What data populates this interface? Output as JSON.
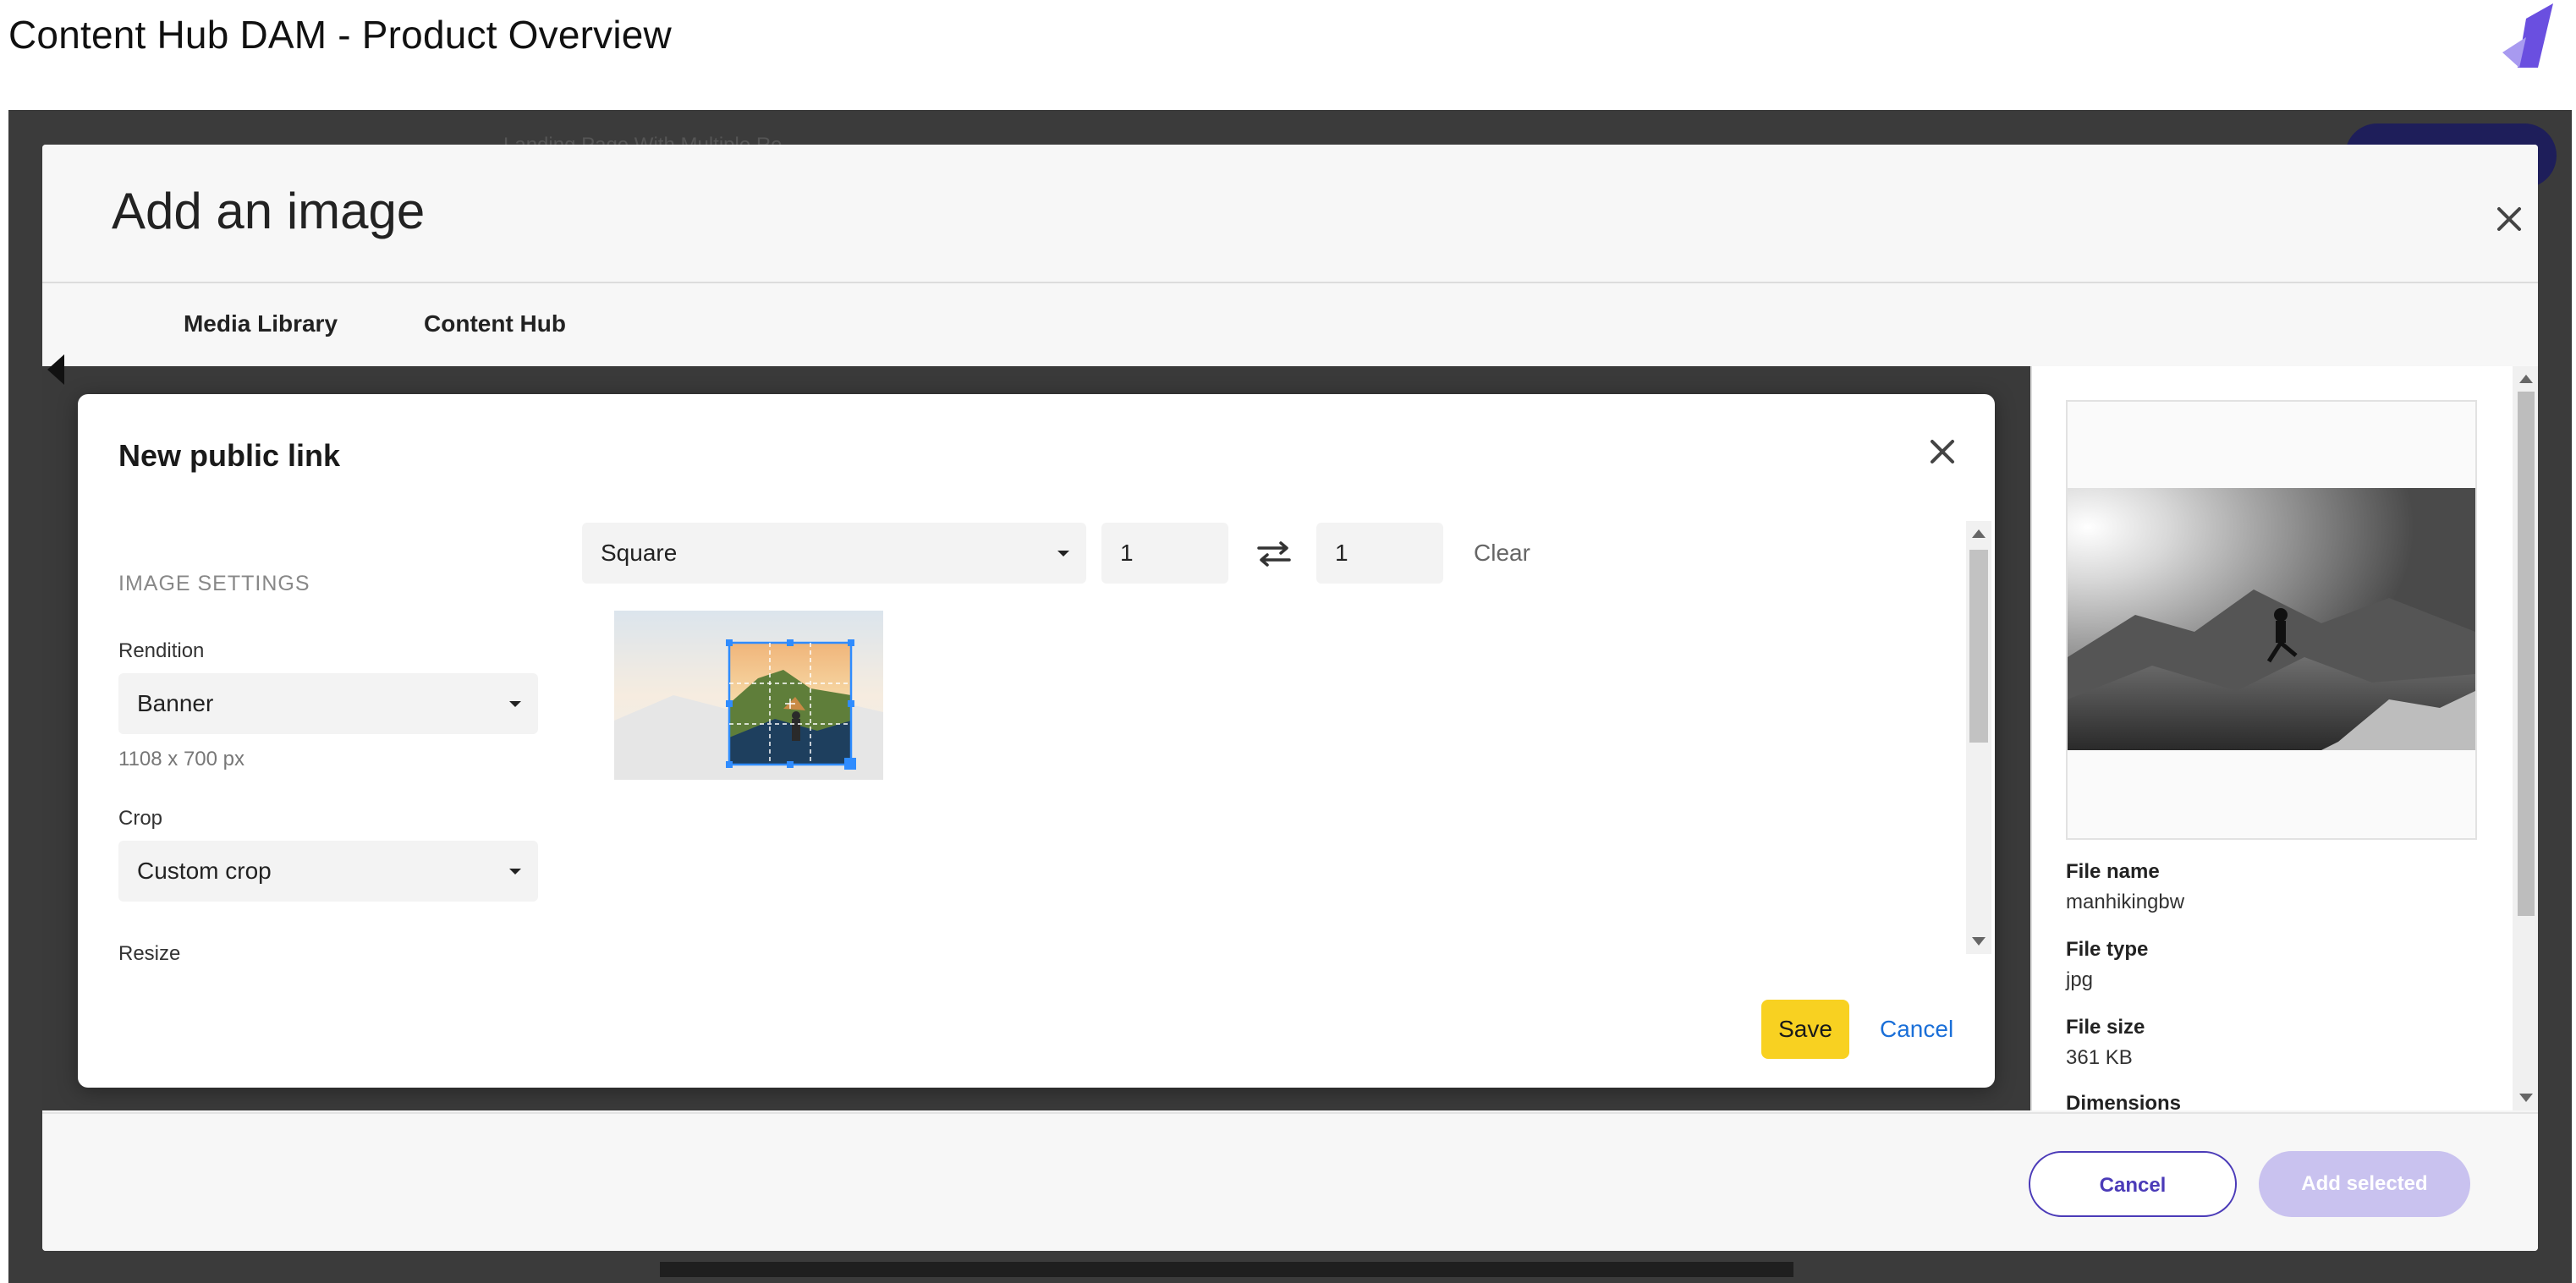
{
  "page": {
    "title": "Content Hub DAM - Product Overview"
  },
  "background": {
    "ghost_text": "Landing Page With Multiple Re..."
  },
  "add_image_modal": {
    "title": "Add an image",
    "tabs": [
      {
        "label": "Media Library",
        "active": false
      },
      {
        "label": "Content Hub",
        "active": true
      }
    ],
    "details": {
      "fields": [
        {
          "label": "File name",
          "value": "manhikingbw"
        },
        {
          "label": "File type",
          "value": "jpg"
        },
        {
          "label": "File size",
          "value": "361 KB"
        },
        {
          "label": "Dimensions",
          "value": ""
        }
      ]
    },
    "footer": {
      "cancel_label": "Cancel",
      "add_selected_label": "Add selected"
    }
  },
  "public_link_dialog": {
    "title": "New public link",
    "section_label": "IMAGE SETTINGS",
    "rendition": {
      "label": "Rendition",
      "value": "Banner",
      "size_hint": "1108 x 700 px"
    },
    "crop": {
      "label": "Crop",
      "value": "Custom crop"
    },
    "resize_label": "Resize",
    "aspect": {
      "preset": "Square",
      "width": "1",
      "height": "1",
      "clear_label": "Clear"
    },
    "save_label": "Save",
    "cancel_label": "Cancel"
  },
  "colors": {
    "accent_purple": "#4b3bb8",
    "disabled_purple": "#c9c2ef",
    "save_yellow": "#f8d121",
    "link_blue": "#1a6fd8",
    "crop_handle_blue": "#2f8cff"
  }
}
